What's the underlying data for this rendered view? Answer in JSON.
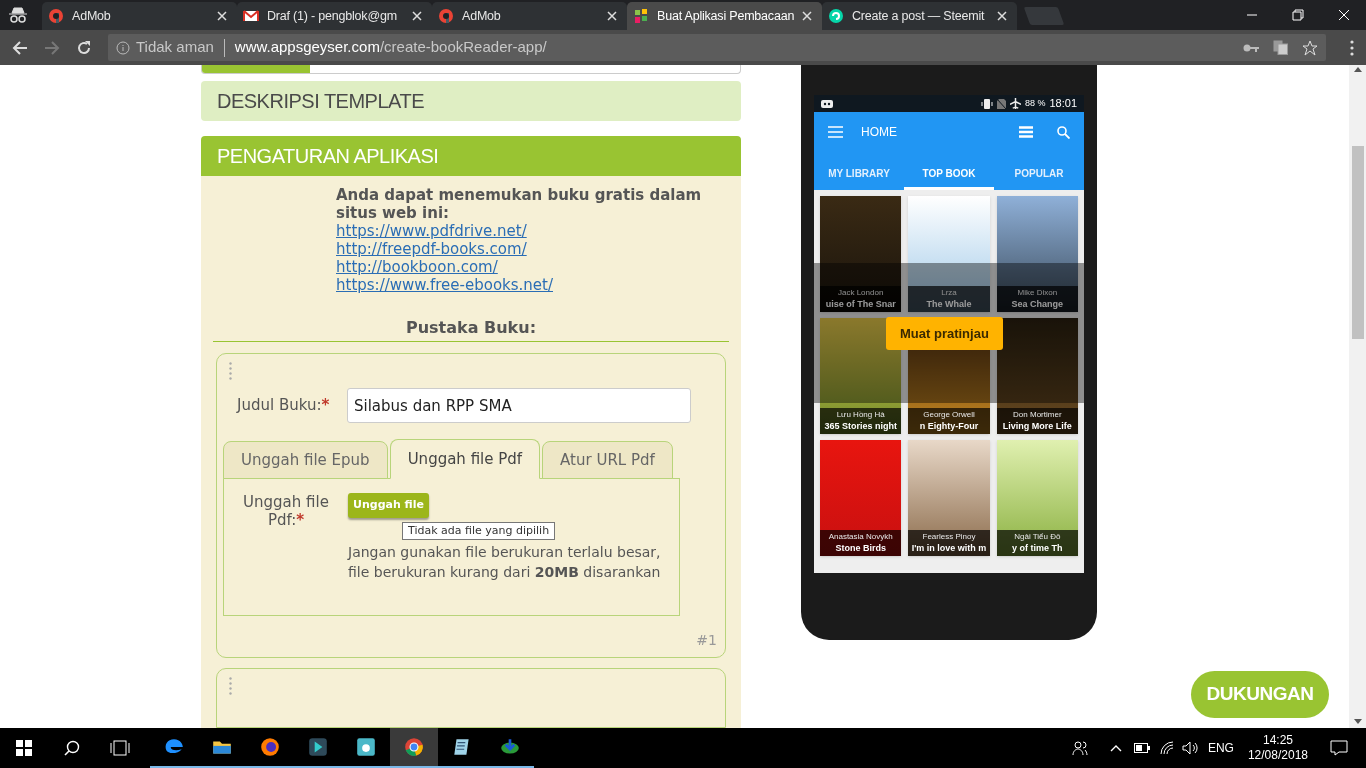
{
  "browser": {
    "tabs": [
      {
        "title": "AdMob",
        "kind": "admob",
        "selected": false
      },
      {
        "title": "Draf (1) - pengblok@gm",
        "kind": "gmail",
        "selected": false
      },
      {
        "title": "AdMob",
        "kind": "admob",
        "selected": false
      },
      {
        "title": "Buat Aplikasi Pembacaan",
        "kind": "appsgeyser",
        "selected": true
      },
      {
        "title": "Create a post — Steemit",
        "kind": "steemit",
        "selected": false
      }
    ],
    "security": "Tidak aman",
    "host": "www.appsgeyser.com",
    "path": "/create-bookReader-app/"
  },
  "form": {
    "progress": {
      "level": 0.2
    },
    "description_header": "DESKRIPSI TEMPLATE",
    "settings_header": "PENGATURAN APLIKASI",
    "info_text": "Anda dapat menemukan buku gratis dalam situs web ini:",
    "links": [
      "https://www.pdfdrive.net/",
      "http://freepdf-books.com/",
      "http://bookboon.com/",
      "https://www.free-ebooks.net/"
    ],
    "library_heading": "Pustaka Buku:",
    "entry": {
      "title_label": "Judul Buku:",
      "required_mark": "*",
      "title_value": "Silabus dan RPP SMA",
      "tabs": [
        {
          "label": "Unggah file Epub",
          "selected": false
        },
        {
          "label": "Unggah file Pdf",
          "selected": true
        },
        {
          "label": "Atur URL Pdf",
          "selected": false
        }
      ],
      "upload_label": "Unggah file Pdf:",
      "upload_required_mark": "*",
      "upload_button": "Unggah file",
      "tooltip": "Tidak ada file yang dipilih",
      "help": "Jangan gunakan file berukuran terlalu besar, file berukuran kurang dari **20MB** disarankan",
      "number": "#1"
    }
  },
  "phone": {
    "battery": "88 %",
    "time": "18:01",
    "app_title": "HOME",
    "tabs": [
      {
        "label": "MY LIBRARY",
        "selected": false
      },
      {
        "label": "TOP BOOK",
        "selected": true
      },
      {
        "label": "POPULAR",
        "selected": false
      }
    ],
    "books": [
      {
        "title": "uise of The Snar",
        "author": "Jack London"
      },
      {
        "title": "The Whale",
        "author": "Lrza"
      },
      {
        "title": "Sea Change",
        "author": "Mike Dixon"
      },
      {
        "title": "365 Stories night",
        "author": "Lưu Hồng Hà"
      },
      {
        "title": "n Eighty-Four",
        "author": "George Orwell"
      },
      {
        "title": "Living More Life",
        "author": "Don Mortimer"
      },
      {
        "title": "Stone Birds",
        "author": "Anastasia Novykh"
      },
      {
        "title": "I'm in love with m",
        "author": "Fearless Pinoy"
      },
      {
        "title": "y of time Th",
        "author": "Ngải Tiểu Đô"
      }
    ],
    "preview_button": "Muat pratinjau"
  },
  "support_button": "DUKUNGAN",
  "taskbar": {
    "apps": [
      {
        "kind": "edge",
        "selected": false
      },
      {
        "kind": "folder",
        "selected": false
      },
      {
        "kind": "firefox",
        "selected": false
      },
      {
        "kind": "editor",
        "selected": false
      },
      {
        "kind": "camera",
        "selected": false
      },
      {
        "kind": "chrome",
        "selected": true
      },
      {
        "kind": "notepad",
        "selected": false
      },
      {
        "kind": "download",
        "selected": false
      }
    ],
    "language": "ENG",
    "time": "14:25",
    "date": "12/08/2018"
  }
}
